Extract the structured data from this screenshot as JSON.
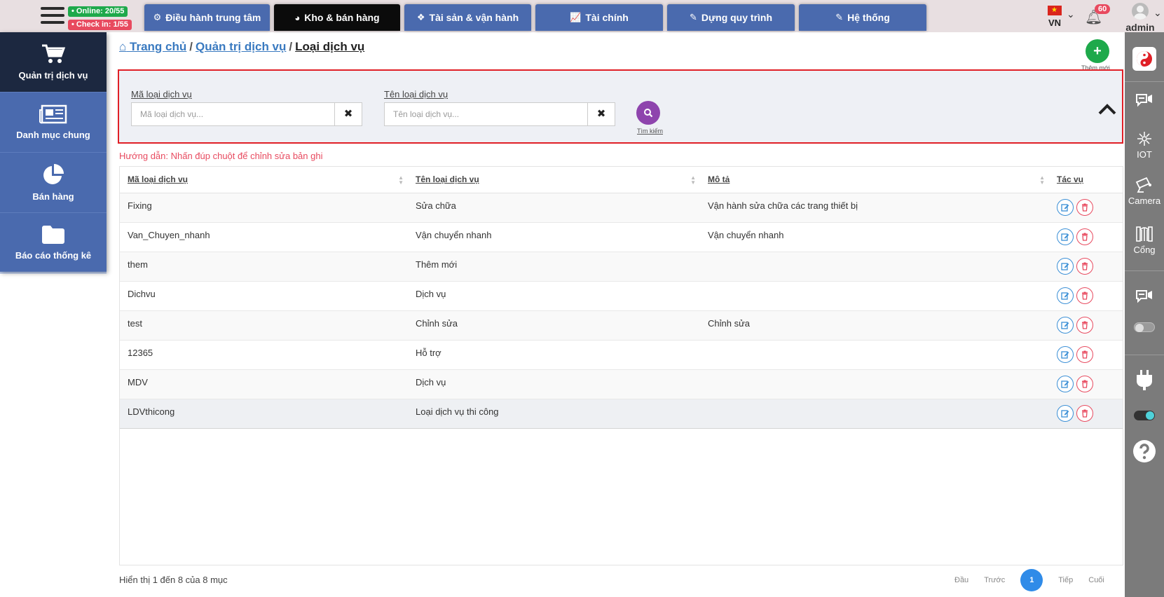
{
  "status": {
    "online": "• Online: 20/55",
    "checkin": "• Check in: 1/55"
  },
  "tabs": [
    {
      "label": "Điều hành trung tâm",
      "icon": "gear-icon"
    },
    {
      "label": "Kho & bán hàng",
      "icon": "pie-chart-icon"
    },
    {
      "label": "Tài sản & vận hành",
      "icon": "cubes-icon"
    },
    {
      "label": "Tài chính",
      "icon": "line-chart-icon"
    },
    {
      "label": "Dựng quy trình",
      "icon": "edit-icon"
    },
    {
      "label": "Hệ thống",
      "icon": "edit-icon"
    }
  ],
  "header": {
    "lang": "VN",
    "notifications": "60",
    "user": "admin"
  },
  "sidebar": [
    {
      "label": "Quản trị dịch vụ",
      "icon": "cart-icon"
    },
    {
      "label": "Danh mục chung",
      "icon": "newspaper-icon"
    },
    {
      "label": "Bán hàng",
      "icon": "pie-chart-icon"
    },
    {
      "label": "Báo cáo thống kê",
      "icon": "folder-icon"
    }
  ],
  "rightbar": {
    "iot": "IOT",
    "camera": "Camera",
    "gate": "Cổng"
  },
  "breadcrumb": {
    "home": "Trang chủ",
    "parent": "Quản trị dịch vụ",
    "current": "Loại dịch vụ"
  },
  "add_button": {
    "label": "Thêm mới"
  },
  "filter": {
    "code_label": "Mã loại dịch vụ",
    "code_placeholder": "Mã loại dịch vụ...",
    "name_label": "Tên loại dịch vụ",
    "name_placeholder": "Tên loại dịch vụ...",
    "search_label": "Tìm kiếm"
  },
  "hint": "Hướng dẫn: Nhấn đúp chuột để chỉnh sửa bản ghi",
  "table": {
    "columns": [
      "Mã loại dịch vụ",
      "Tên loại dịch vụ",
      "Mô tả",
      "Tác vụ"
    ],
    "rows": [
      [
        "Fixing",
        "Sửa chữa",
        "Vận hành sửa chữa các trang thiết bị"
      ],
      [
        "Van_Chuyen_nhanh",
        "Vận chuyển nhanh",
        "Vận chuyển nhanh"
      ],
      [
        "them",
        "Thêm mới",
        ""
      ],
      [
        "Dichvu",
        "Dịch vụ",
        ""
      ],
      [
        "test",
        "Chỉnh sửa",
        "Chỉnh sửa"
      ],
      [
        "12365",
        "Hỗ trợ",
        ""
      ],
      [
        "MDV",
        "Dịch vụ",
        ""
      ],
      [
        "LDVthicong",
        "Loại dịch vụ thi công",
        ""
      ]
    ]
  },
  "footer": {
    "info": "Hiển thị 1 đến 8 của 8 mục",
    "first": "Đầu",
    "prev": "Trước",
    "page": "1",
    "next": "Tiếp",
    "last": "Cuối"
  }
}
